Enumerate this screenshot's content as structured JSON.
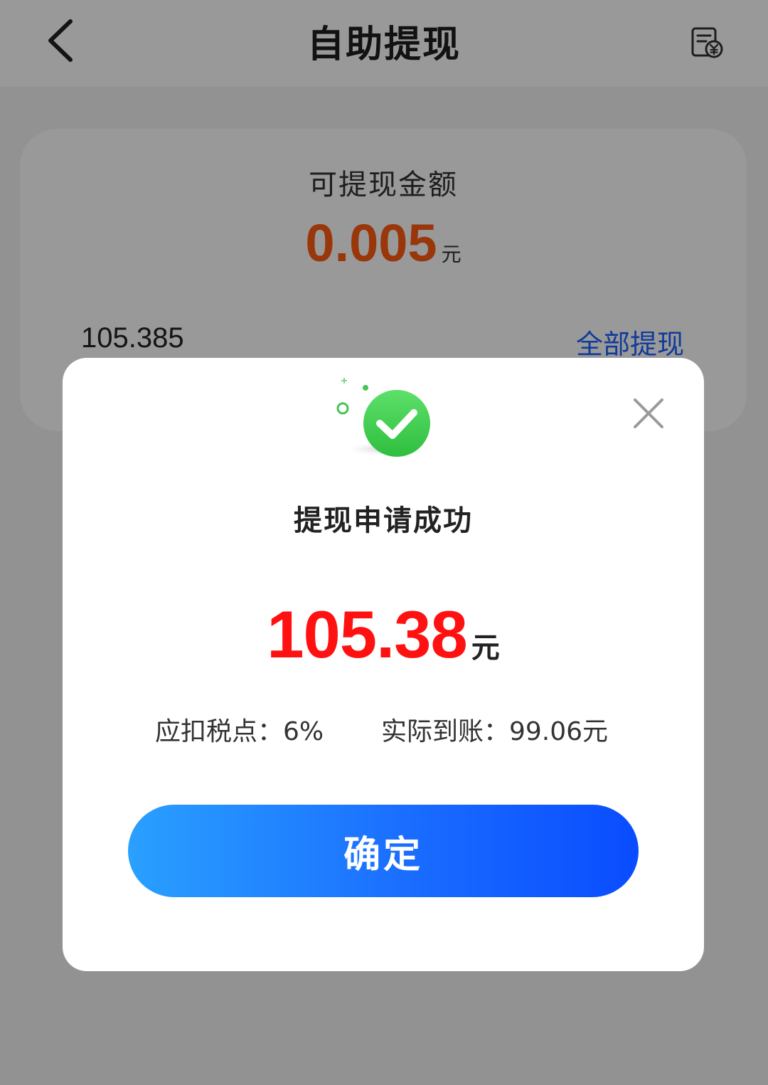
{
  "header": {
    "title": "自助提现",
    "back_icon": "chevron-left-icon",
    "records_icon": "yuan-receipt-icon"
  },
  "balance_card": {
    "label": "可提现金额",
    "amount": "0.005",
    "unit": "元",
    "input_value": "105.385",
    "withdraw_all_label": "全部提现"
  },
  "modal": {
    "illustration_icon": "success-check-icon",
    "close_icon": "close-icon",
    "title": "提现申请成功",
    "amount": "105.38",
    "unit": "元",
    "tax_text": "应扣税点：6%",
    "actual_text": "实际到账：99.06元",
    "confirm_label": "确定"
  },
  "colors": {
    "balance_amount": "#ff5a12",
    "modal_amount": "#ff1111",
    "link_blue": "#1a63ff",
    "button_gradient_start": "#2aa0ff",
    "button_gradient_end": "#0a4cff",
    "success_green": "#3ccf4e"
  }
}
